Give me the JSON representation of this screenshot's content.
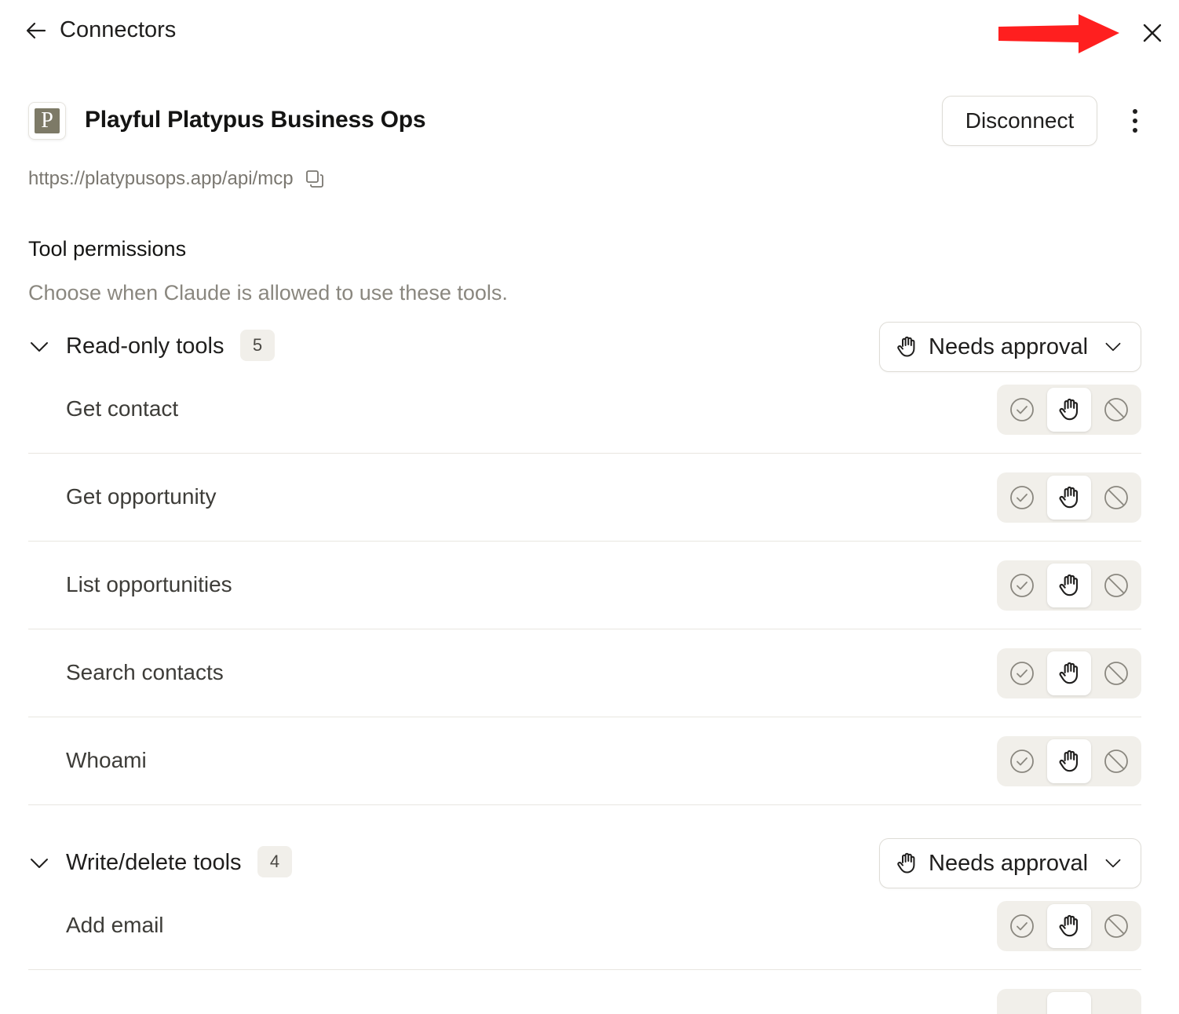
{
  "nav": {
    "back_label": "Connectors"
  },
  "connector": {
    "logo_letter": "P",
    "title": "Playful Platypus Business Ops",
    "disconnect_label": "Disconnect",
    "url": "https://platypusops.app/api/mcp"
  },
  "permissions": {
    "title": "Tool permissions",
    "description": "Choose when Claude is allowed to use these tools."
  },
  "groups": [
    {
      "label": "Read-only tools",
      "count": "5",
      "setting": "Needs approval",
      "tools": [
        "Get contact",
        "Get opportunity",
        "List opportunities",
        "Search contacts",
        "Whoami"
      ]
    },
    {
      "label": "Write/delete tools",
      "count": "4",
      "setting": "Needs approval",
      "tools": [
        "Add email"
      ]
    }
  ],
  "icons": {
    "back": "arrow-left-icon",
    "close": "close-icon",
    "more": "more-vertical-icon",
    "copy": "copy-icon",
    "allow": "check-circle-icon",
    "approval": "hand-icon",
    "block": "block-icon",
    "chevron": "chevron-down-icon"
  },
  "colors": {
    "annotation_arrow": "#ff1f1f",
    "logo_bg": "#7d7a67"
  }
}
